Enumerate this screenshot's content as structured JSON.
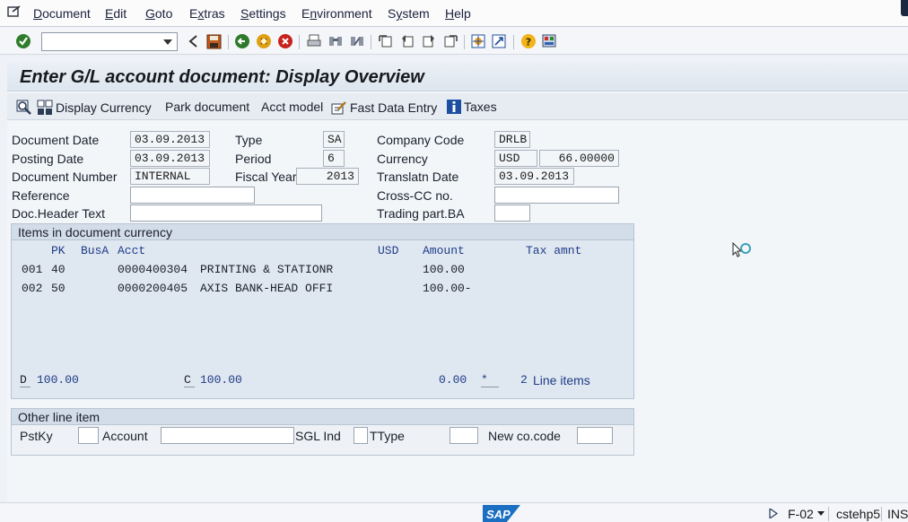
{
  "menu": [
    "Document",
    "Edit",
    "Goto",
    "Extras",
    "Settings",
    "Environment",
    "System",
    "Help"
  ],
  "menu_mnemonics": [
    "D",
    "E",
    "G",
    "x",
    "S",
    "n",
    "y",
    "H"
  ],
  "toolbar": {
    "command_field_value": "",
    "icons": [
      "enter-icon",
      "back-icon",
      "save-icon",
      "back-nav-icon",
      "exit-icon",
      "cancel-icon",
      "print-icon",
      "find-icon",
      "find-next-icon",
      "first-page-icon",
      "prev-page-icon",
      "next-page-icon",
      "last-page-icon",
      "create-session-icon",
      "shortcut-icon",
      "help-icon",
      "layout-icon"
    ]
  },
  "title": "Enter G/L account document: Display Overview",
  "app_toolbar": {
    "display_currency": "Display Currency",
    "park_document": "Park document",
    "acct_model": "Acct model",
    "fast_data_entry": "Fast Data Entry",
    "taxes": "Taxes"
  },
  "header": {
    "document_date_label": "Document Date",
    "document_date": "03.09.2013",
    "posting_date_label": "Posting Date",
    "posting_date": "03.09.2013",
    "document_number_label": "Document Number",
    "document_number": "INTERNAL",
    "reference_label": "Reference",
    "reference": "",
    "doc_header_text_label": "Doc.Header Text",
    "doc_header_text": "",
    "type_label": "Type",
    "type": "SA",
    "period_label": "Period",
    "period": "6",
    "fiscal_year_label": "Fiscal Year",
    "fiscal_year": "2013",
    "company_code_label": "Company Code",
    "company_code": "DRLB",
    "currency_label": "Currency",
    "currency": "USD",
    "exchange_rate": "66.00000",
    "translatn_date_label": "Translatn Date",
    "translatn_date": "03.09.2013",
    "cross_cc_label": "Cross-CC no.",
    "cross_cc": "",
    "trading_part_label": "Trading part.BA",
    "trading_part": ""
  },
  "items": {
    "group_title": "Items in document currency",
    "headers": {
      "pk": "PK",
      "busa": "BusA",
      "acct": "Acct",
      "currency": "USD",
      "amount": "Amount",
      "tax": "Tax amnt"
    },
    "rows": [
      {
        "no": "001",
        "pk": "40",
        "acct": "0000400304",
        "text": "PRINTING & STATIONR",
        "amount": "100.00"
      },
      {
        "no": "002",
        "pk": "50",
        "acct": "0000200405",
        "text": "AXIS BANK-HEAD OFFI",
        "amount": "100.00-"
      }
    ],
    "totals": {
      "d_label": "D",
      "debit": "100.00",
      "c_label": "C",
      "credit": "100.00",
      "balance": "0.00",
      "star": "*",
      "line_count": "2",
      "line_items_label": "Line items"
    }
  },
  "other_line_item": {
    "group_title": "Other line item",
    "pstky_label": "PstKy",
    "pstky": "",
    "account_label": "Account",
    "account": "",
    "sgl_ind_label": "SGL Ind",
    "sgl_ind": "",
    "ttype_label": "TType",
    "ttype": "",
    "new_co_code_label": "New co.code",
    "new_co_code": ""
  },
  "status_bar": {
    "transaction": "F-02",
    "server": "cstehp5",
    "mode": "INS",
    "logo": "SAP"
  },
  "colors": {
    "label_blue": "#1f3c88",
    "title_bg": "#dde5ee",
    "group_bg": "#dfe7f0"
  }
}
